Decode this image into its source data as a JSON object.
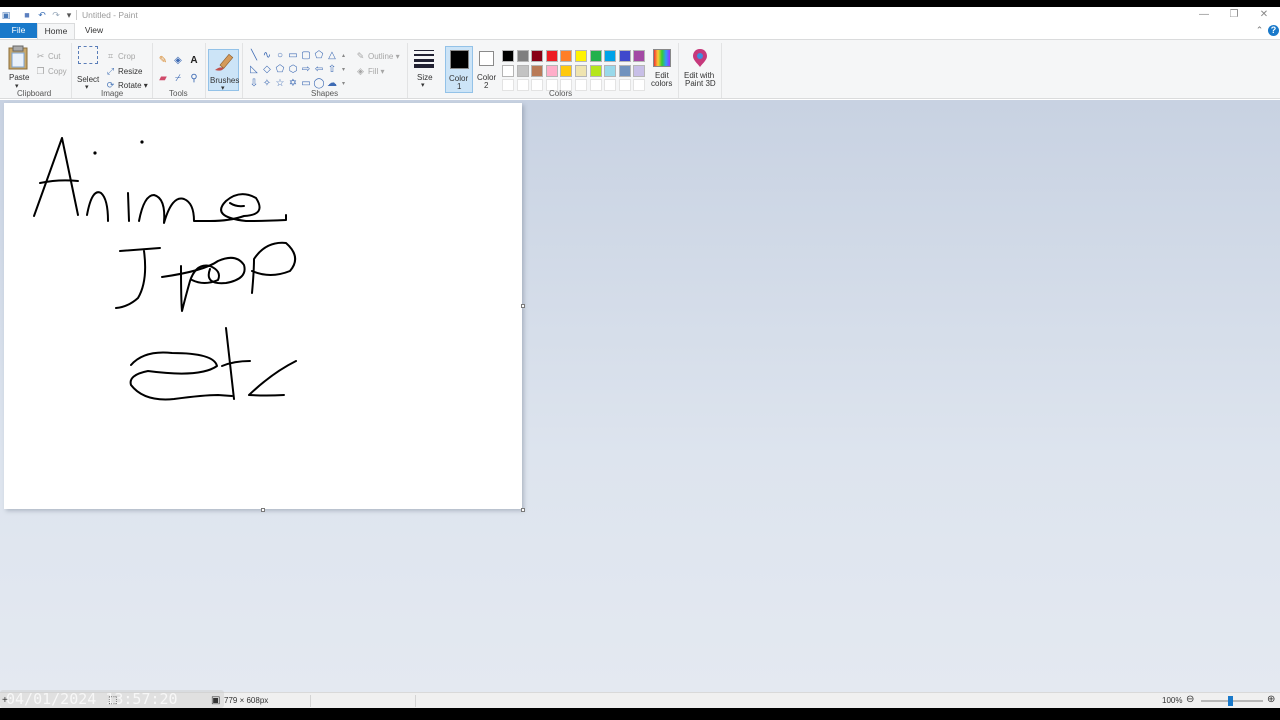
{
  "window": {
    "title": "Untitled - Paint"
  },
  "tabs": {
    "file": "File",
    "home": "Home",
    "view": "View"
  },
  "clipboard": {
    "paste": "Paste",
    "cut": "Cut",
    "copy": "Copy",
    "group": "Clipboard"
  },
  "image": {
    "select": "Select",
    "crop": "Crop",
    "resize": "Resize",
    "rotate": "Rotate",
    "group": "Image"
  },
  "tools": {
    "group": "Tools"
  },
  "brushes": {
    "label": "Brushes"
  },
  "shapes": {
    "outline": "Outline",
    "fill": "Fill",
    "group": "Shapes"
  },
  "size": {
    "label": "Size"
  },
  "colors": {
    "color1_label": "Color",
    "color1_num": "1",
    "color2_label": "Color",
    "color2_num": "2",
    "edit_colors_1": "Edit",
    "edit_colors_2": "colors",
    "paint3d_1": "Edit with",
    "paint3d_2": "Paint 3D",
    "group": "Colors",
    "color1_value": "#000000",
    "color2_value": "#ffffff",
    "palette_row1": [
      "#000000",
      "#7f7f7f",
      "#880015",
      "#ed1c24",
      "#ff7f27",
      "#fff200",
      "#22b14c",
      "#00a2e8",
      "#3f48cc",
      "#a349a4"
    ],
    "palette_row2": [
      "#ffffff",
      "#c3c3c3",
      "#b97a57",
      "#ffaec9",
      "#ffc90e",
      "#efe4b0",
      "#b5e61d",
      "#99d9ea",
      "#7092be",
      "#c8bfe7"
    ],
    "palette_row3": [
      "#ffffff",
      "#ffffff",
      "#ffffff",
      "#ffffff",
      "#ffffff",
      "#ffffff",
      "#ffffff",
      "#ffffff",
      "#ffffff",
      "#ffffff"
    ]
  },
  "status": {
    "timestamp": "04/01/2024 13:57:20",
    "canvas_size": "779 × 608px",
    "zoom": "100%"
  },
  "colors_theme": {
    "accent": "#1979ca",
    "workspace": "#c8d2e2"
  }
}
